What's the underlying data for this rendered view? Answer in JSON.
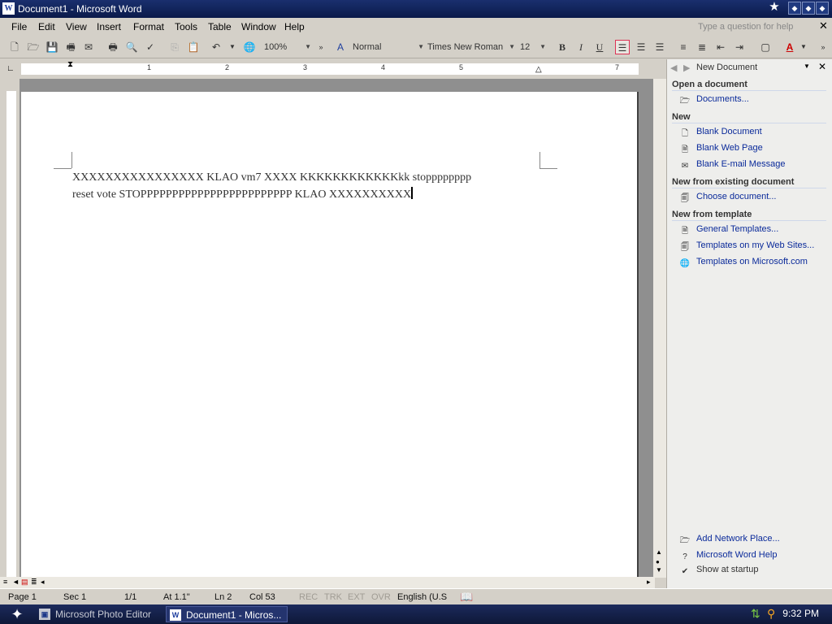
{
  "window": {
    "title": "Document1 - Microsoft Word",
    "app_icon": "W"
  },
  "menu": [
    "File",
    "Edit",
    "View",
    "Insert",
    "Format",
    "Tools",
    "Table",
    "Window",
    "Help"
  ],
  "help_placeholder": "Type a question for help",
  "toolbar": {
    "zoom": "100%",
    "style": "Normal",
    "font": "Times New Roman",
    "size": "12",
    "bold": "B",
    "italic": "I",
    "underline": "U",
    "font_color": "A"
  },
  "ruler": {
    "numbers": [
      "1",
      "2",
      "3",
      "4",
      "5",
      "7"
    ]
  },
  "document": {
    "lines": [
      "XXXXXXXXXXXXXXXX KLAO vm7 XXXX KKKKKKKKKKKKkk stopppppppp",
      "reset vote STOPPPPPPPPPPPPPPPPPPPPPPPP KLAO XXXXXXXXXX"
    ]
  },
  "taskpane": {
    "title": "New Document",
    "sections": {
      "open": "Open a document",
      "new": "New",
      "existing": "New from existing document",
      "template": "New from template"
    },
    "links": {
      "documents": "Documents...",
      "blank_document": "Blank Document",
      "blank_web_page": "Blank Web Page",
      "blank_email": "Blank E-mail Message",
      "choose_document": "Choose document...",
      "general_templates": "General Templates...",
      "templates_web_sites": "Templates on my Web Sites...",
      "templates_microsoft": "Templates on Microsoft.com",
      "add_network_place": "Add Network Place...",
      "word_help": "Microsoft Word Help"
    },
    "show_at_startup": "Show at startup"
  },
  "status": {
    "page": "Page 1",
    "sec": "Sec 1",
    "pages": "1/1",
    "at": "At 1.1\"",
    "ln": "Ln 2",
    "col": "Col 53",
    "rec": "REC",
    "trk": "TRK",
    "ext": "EXT",
    "ovr": "OVR",
    "lang": "English (U.S"
  },
  "taskbar": {
    "items": [
      "Microsoft Photo Editor",
      "Document1 - Micros..."
    ],
    "clock": "9:32 PM"
  }
}
